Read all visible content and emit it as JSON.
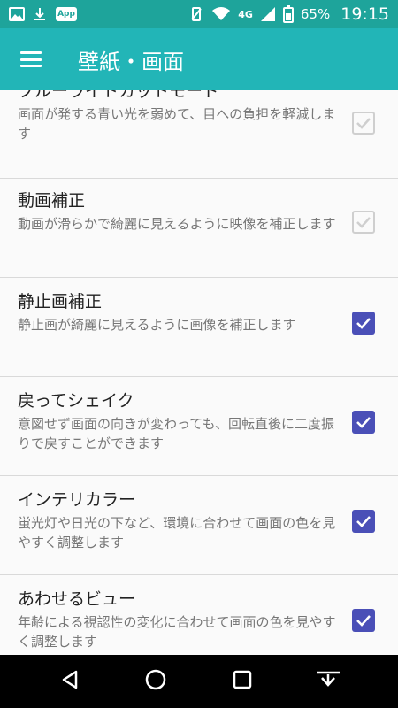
{
  "status_bar": {
    "network_label": "4G",
    "battery": "65%",
    "time": "19:15",
    "app_badge": "App"
  },
  "app_bar": {
    "title": "壁紙・画面",
    "menu_icon": "hamburger-menu-icon"
  },
  "settings": [
    {
      "title": "ブルーライトカットモード",
      "summary": "画面が発する青い光を弱めて、目への負担を軽減します",
      "checked": true,
      "enabled": false
    },
    {
      "title": "動画補正",
      "summary": "動画が滑らかで綺麗に見えるように映像を補正します",
      "checked": true,
      "enabled": false
    },
    {
      "title": "静止画補正",
      "summary": "静止画が綺麗に見えるように画像を補正します",
      "checked": true,
      "enabled": true
    },
    {
      "title": "戻ってシェイク",
      "summary": "意図せず画面の向きが変わっても、回転直後に二度振りで戻すことができます",
      "checked": true,
      "enabled": true
    },
    {
      "title": "インテリカラー",
      "summary": "蛍光灯や日光の下など、環境に合わせて画面の色を見やすく調整します",
      "checked": true,
      "enabled": true
    },
    {
      "title": "あわせるビュー",
      "summary": "年齢による視認性の変化に合わせて画面の色を見やすく調整します",
      "checked": true,
      "enabled": true
    }
  ],
  "nav_bar": {
    "icons": [
      "back-icon",
      "home-icon",
      "recents-icon",
      "notification-pull-icon"
    ]
  },
  "colors": {
    "status_bar": "#1ea49b",
    "app_bar": "#22b5b7",
    "checkbox_active": "#4a4fb7",
    "checkbox_disabled": "#cfcfcf"
  }
}
